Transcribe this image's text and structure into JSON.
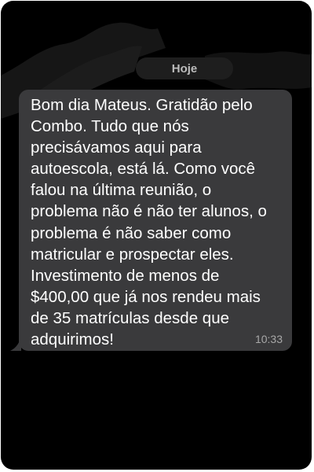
{
  "chat": {
    "date_separator": "Hoje",
    "message": {
      "text": "Bom dia Mateus. Gratidão pelo Combo. Tudo que nós precisávamos aqui para autoescola, está lá. Como você falou na última reunião, o problema não é não ter alunos, o problema é não saber como matricular e prospectar eles. Investimento de menos de $400,00 que já nos rendeu mais de 35 matrículas desde que adquirimos!",
      "time": "10:33"
    }
  },
  "colors": {
    "background": "#000000",
    "bubble": "#3a3a3c",
    "text": "#ffffff",
    "timestamp": "#a8a8a8"
  }
}
